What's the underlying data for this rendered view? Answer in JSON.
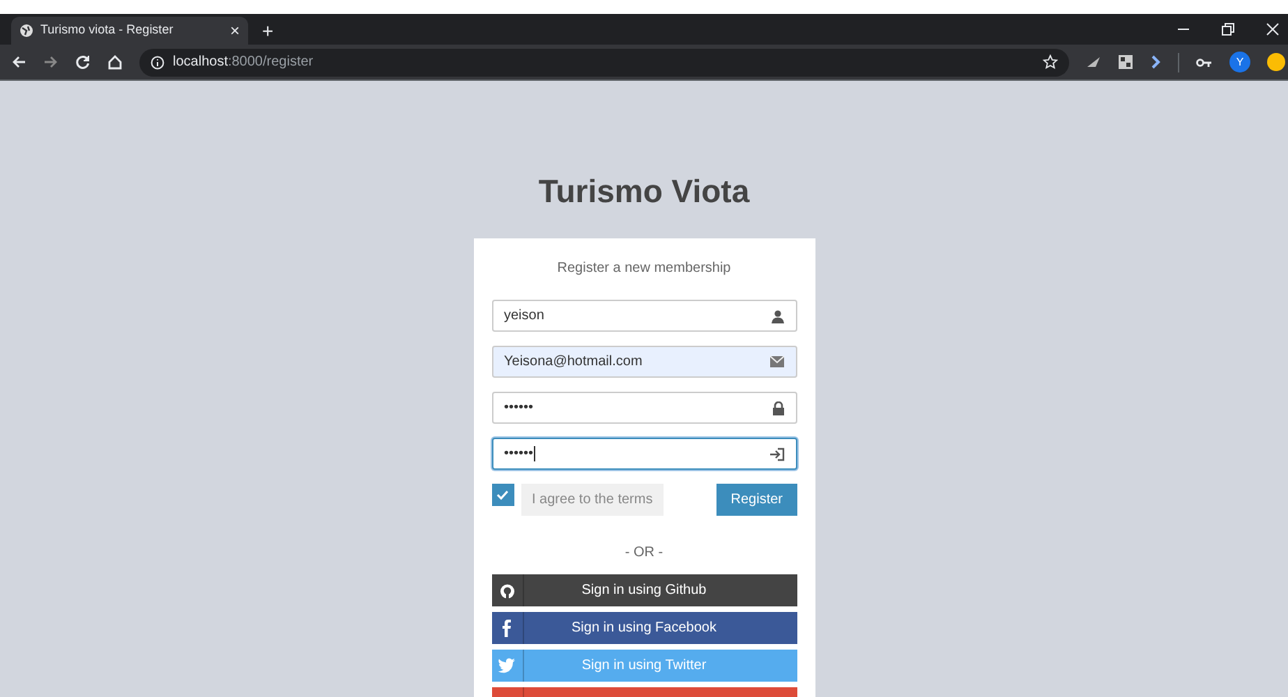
{
  "browser": {
    "tab": {
      "title": "Turismo viota - Register",
      "close": "×"
    },
    "new_tab": "+",
    "url": {
      "host": "localhost",
      "path": ":8000/register"
    },
    "profile_initial": "Y"
  },
  "page": {
    "title": "Turismo Viota",
    "box_heading": "Register a new membership",
    "fields": [
      {
        "kind": "user",
        "value": "yeison",
        "autofilled": false,
        "focused": false
      },
      {
        "kind": "email",
        "value": "Yeisona@hotmail.com",
        "autofilled": true,
        "focused": false
      },
      {
        "kind": "password",
        "value": "••••••",
        "autofilled": false,
        "focused": false
      },
      {
        "kind": "retype",
        "value": "••••••",
        "autofilled": false,
        "focused": true
      }
    ],
    "terms": {
      "label": "I agree to the terms",
      "checked": true
    },
    "register_button": "Register",
    "separator": "- OR -",
    "social": [
      {
        "kind": "github",
        "label": "Sign in using Github"
      },
      {
        "kind": "facebook",
        "label": "Sign in using Facebook"
      },
      {
        "kind": "twitter",
        "label": "Sign in using Twitter"
      },
      {
        "kind": "google"
      }
    ]
  }
}
